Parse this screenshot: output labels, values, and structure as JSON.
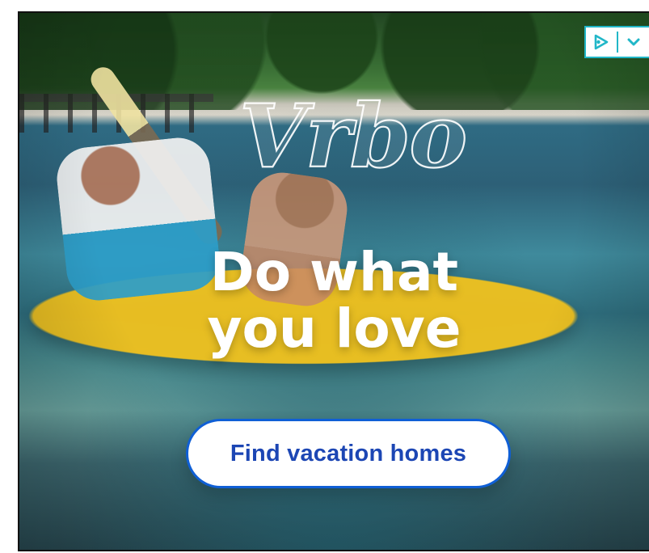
{
  "ad": {
    "logo_text": "Vrbo",
    "headline_lines": [
      "Do what",
      "you love"
    ],
    "cta_label": "Find vacation homes",
    "top_icons": [
      {
        "name": "adchoices-icon"
      },
      {
        "name": "chevron-down-icon"
      }
    ]
  },
  "colors": {
    "cta_border": "#0F5FD6",
    "cta_text": "#1C46B4",
    "adchoices": "#21B7C8"
  }
}
